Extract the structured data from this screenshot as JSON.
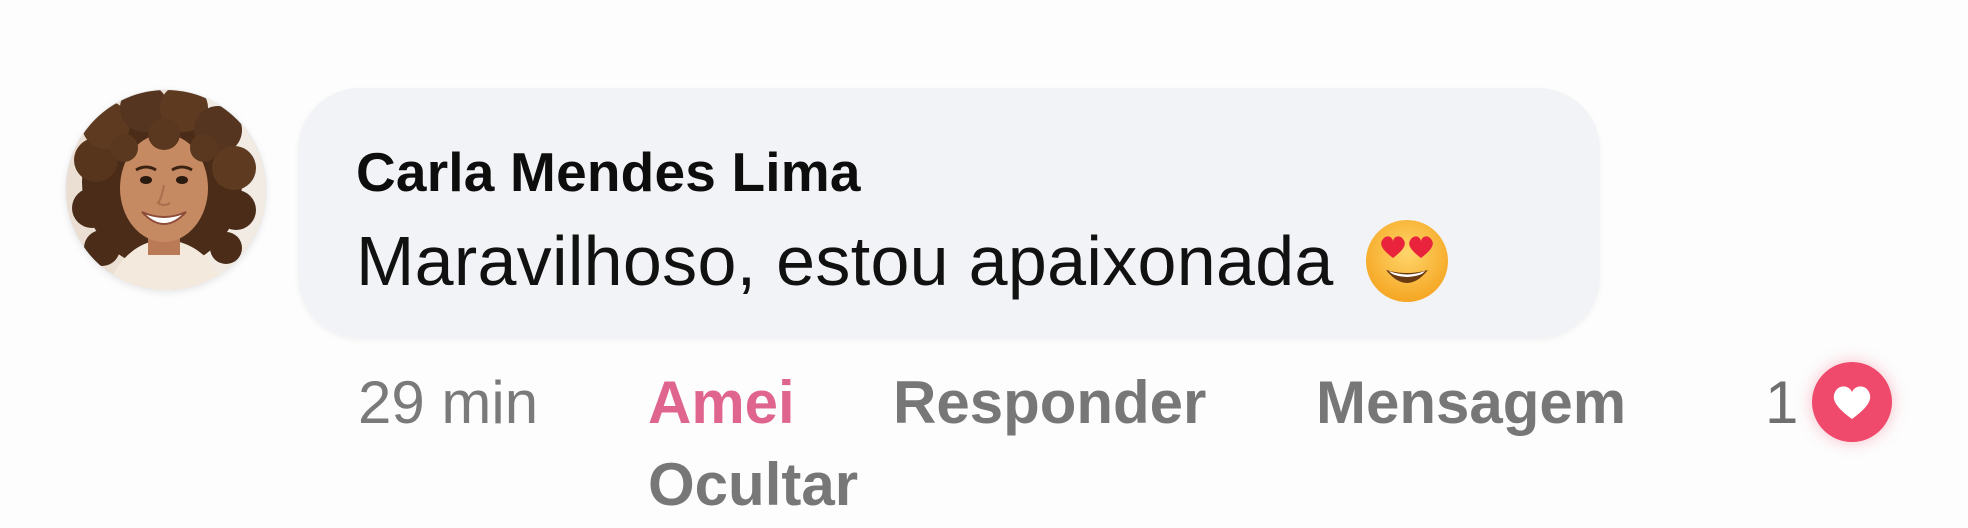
{
  "comment": {
    "author": "Carla Mendes Lima",
    "text": "Maravilhoso, estou apaixonada",
    "emoji": "smiling-face-with-heart-eyes",
    "time": "29 min",
    "actions": {
      "love": "Amei",
      "reply": "Responder",
      "message": "Mensagem",
      "hide": "Ocultar"
    },
    "reactions": {
      "count": "1",
      "type": "heart"
    }
  },
  "colors": {
    "bubble": "#f2f3f6",
    "love_active": "#e0658e",
    "action_text": "#777777",
    "reaction_badge": "#ef4a6b"
  }
}
